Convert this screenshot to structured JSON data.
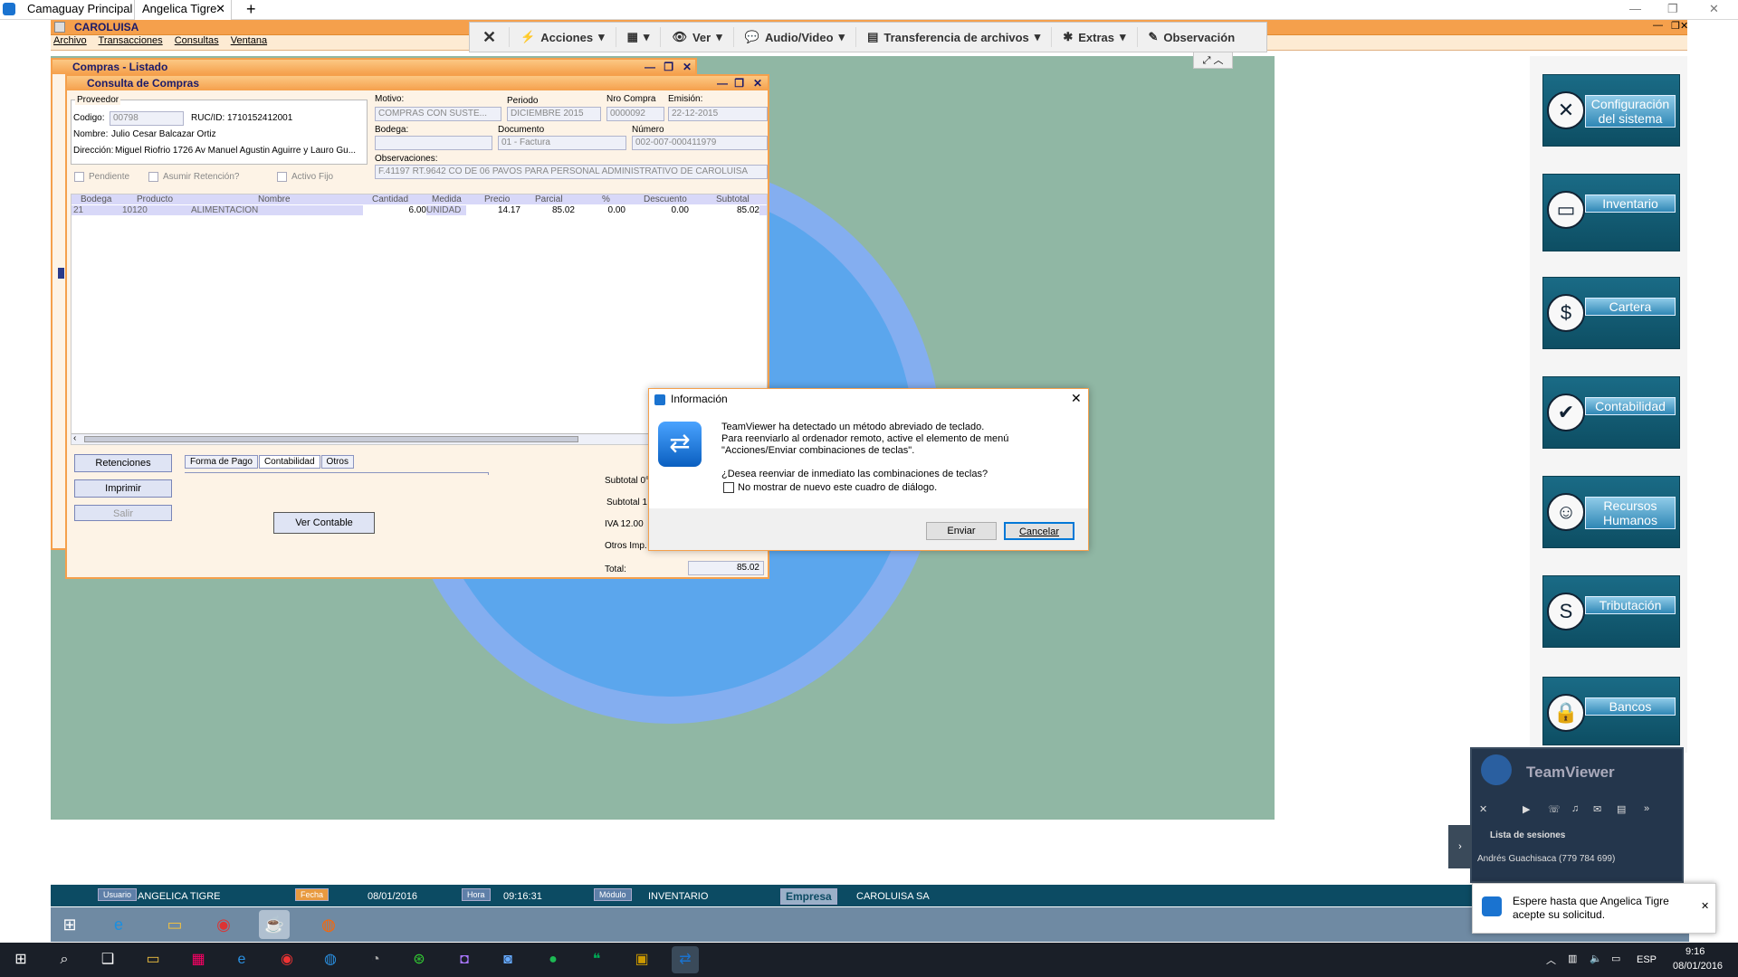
{
  "browser_tabs": [
    "Camaguay Principal",
    "Angelica Tigre"
  ],
  "app": {
    "title": "CAROLUISA",
    "menu": [
      "Archivo",
      "Transacciones",
      "Consultas",
      "Ventana"
    ]
  },
  "tv_toolbar": {
    "close": "✕",
    "items": [
      "Acciones",
      "",
      "Ver",
      "Audio/Video",
      "Transferencia de archivos",
      "Extras",
      "Observación"
    ]
  },
  "listado": {
    "title": "Compras - Listado"
  },
  "consulta": {
    "title": "Consulta de Compras",
    "proveedor_label": "Proveedor",
    "codigo_label": "Codigo:",
    "codigo": "00798",
    "ruc_label": "RUC/ID:",
    "ruc": "1710152412001",
    "nombre_label": "Nombre:",
    "nombre": "Julio Cesar Balcazar Ortiz",
    "direccion_label": "Dirección:",
    "direccion": "Miguel Riofrio 1726 Av Manuel Agustin Aguirre y Lauro Gu...",
    "motivo_label": "Motivo:",
    "motivo": "COMPRAS CON SUSTE...",
    "periodo_label": "Periodo",
    "periodo": "DICIEMBRE 2015",
    "nro_label": "Nro Compra",
    "nro": "0000092",
    "emision_label": "Emisión:",
    "emision": "22-12-2015",
    "bodega_label": "Bodega:",
    "bodega": "",
    "documento_label": "Documento",
    "documento": "01 - Factura",
    "numero_label": "Número",
    "numero": "002-007-000411979",
    "obs_label": "Observaciones:",
    "obs": "F.41197 RT.9642 CO DE 06 PAVOS PARA PERSONAL ADMINISTRATIVO DE CAROLUISA",
    "checks": [
      "Pendiente",
      "Asumir Retención?",
      "Activo Fijo"
    ],
    "columns": [
      "Bodega",
      "Producto",
      "Nombre",
      "Cantidad",
      "Medida",
      "Precio",
      "Parcial",
      "%",
      "Descuento",
      "Subtotal"
    ],
    "row": [
      "21",
      "10120",
      "ALIMENTACION",
      "6.00",
      "UNIDAD",
      "14.17",
      "85.02",
      "0.00",
      "0.00",
      "85.02"
    ],
    "buttons": {
      "retenciones": "Retenciones",
      "imprimir": "Imprimir",
      "salir": "Salir",
      "ver_contable": "Ver Contable"
    },
    "tabs": [
      "Forma de Pago",
      "Contabilidad",
      "Otros"
    ],
    "totals": {
      "subtotal0": "Subtotal 0°",
      "subtotal1": "Subtotal 1",
      "iva": "IVA 12.00",
      "otros": "Otros Imp.",
      "total_label": "Total:",
      "total": "85.02"
    }
  },
  "dialog": {
    "title": "Información",
    "line1": "TeamViewer ha detectado un método abreviado de teclado.",
    "line2": "Para reenviarlo al ordenador remoto, active el elemento de menú",
    "line3": "\"Acciones/Enviar combinaciones de teclas\".",
    "question": "¿Desea reenviar de inmediato las combinaciones de teclas?",
    "checkbox": "No mostrar de nuevo este cuadro de diálogo.",
    "send": "Enviar",
    "cancel": "Cancelar"
  },
  "modules": [
    "Configuración del sistema",
    "Inventario",
    "Cartera",
    "Contabilidad",
    "Recursos Humanos",
    "Tributación",
    "Bancos"
  ],
  "status": {
    "usuario_label": "Usuario",
    "usuario": "ANGELICA TIGRE",
    "fecha_label": "Fecha",
    "fecha": "08/01/2016",
    "hora_label": "Hora",
    "hora": "09:16:31",
    "modulo_label": "Módulo",
    "modulo": "INVENTARIO",
    "empresa_label": "Empresa",
    "empresa": "CAROLUISA SA"
  },
  "tv_panel": {
    "brand": "TeamViewer",
    "sessions": "Lista de sesiones",
    "session_item": "Andrés Guachisaca (779 784 699)"
  },
  "toast": {
    "text": "Espere hasta que Angelica Tigre acepte su solicitud."
  },
  "clock": {
    "time": "9:16",
    "date": "08/01/2016",
    "lang": "ESP"
  }
}
